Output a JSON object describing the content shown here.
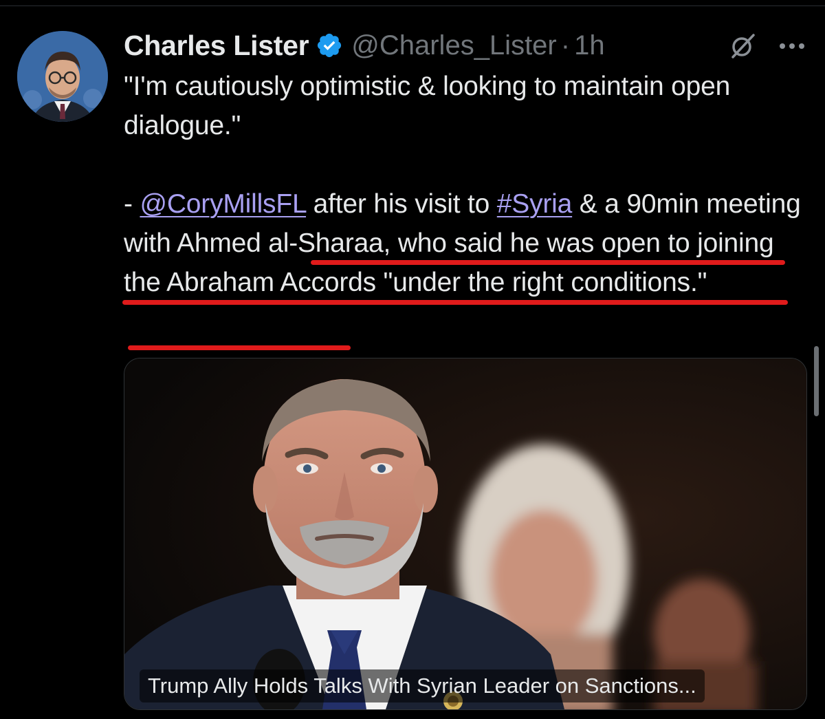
{
  "author": {
    "display_name": "Charles Lister",
    "handle": "@Charles_Lister",
    "separator": "·",
    "timestamp": "1h"
  },
  "icons": {
    "verified": "verified-badge-icon",
    "grok": "grok-icon",
    "more": "more-icon"
  },
  "tweet": {
    "line_quote": "\"I'm cautiously optimistic & looking to maintain open dialogue.\"",
    "dash": "- ",
    "mention": "@CoryMillsFL",
    "text_after_mention": " after his visit to ",
    "hashtag": "#Syria",
    "text_after_hashtag": " & a 90min meeting with Ahmed al-Sharaa, who said he was open to joining the Abraham Accords \"under the right conditions.\""
  },
  "media": {
    "caption": "Trump Ally Holds Talks With Syrian Leader on Sanctions..."
  },
  "colors": {
    "background": "#000000",
    "text": "#e7e9ea",
    "muted": "#71767b",
    "link": "#a9a0f2",
    "verified": "#1d9bf0",
    "annotation_red": "#e01b1b"
  }
}
